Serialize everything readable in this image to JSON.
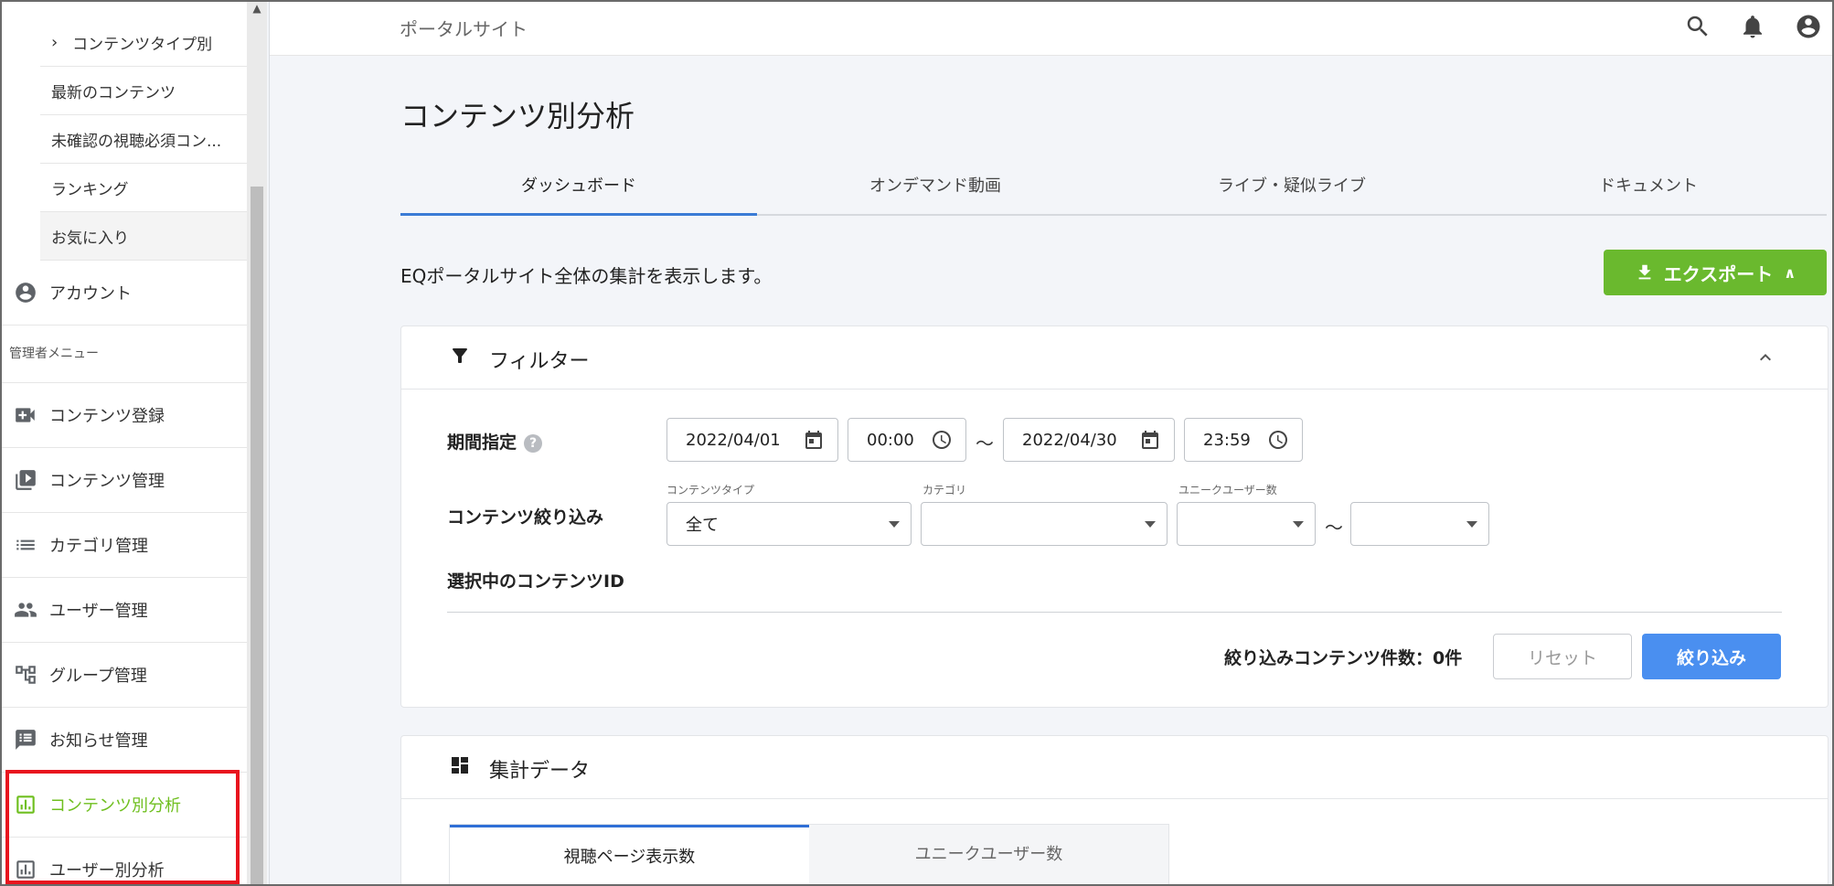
{
  "sidebar": {
    "sub_items": [
      {
        "label": "コンテンツタイプ別"
      },
      {
        "label": "最新のコンテンツ"
      },
      {
        "label": "未確認の視聴必須コン..."
      },
      {
        "label": "ランキング"
      },
      {
        "label": "お気に入り"
      }
    ],
    "account": {
      "label": "アカウント",
      "icon": "account-circle-icon"
    },
    "admin_section": "管理者メニュー",
    "admin_items": [
      {
        "label": "コンテンツ登録",
        "icon": "video-add-icon"
      },
      {
        "label": "コンテンツ管理",
        "icon": "video-library-icon"
      },
      {
        "label": "カテゴリ管理",
        "icon": "list-icon"
      },
      {
        "label": "ユーザー管理",
        "icon": "people-icon"
      },
      {
        "label": "グループ管理",
        "icon": "group-tree-icon"
      },
      {
        "label": "お知らせ管理",
        "icon": "announcement-icon"
      },
      {
        "label": "コンテンツ別分析",
        "icon": "analytics-icon",
        "active": true
      },
      {
        "label": "ユーザー別分析",
        "icon": "analytics-icon"
      }
    ],
    "active_color": "#6fbf1f",
    "highlight_box_color": "#e8141e"
  },
  "header": {
    "portal_title": "ポータルサイト",
    "icons": [
      "search-icon",
      "bell-icon",
      "account-circle-icon"
    ]
  },
  "main": {
    "title": "コンテンツ別分析",
    "tabs": [
      {
        "label": "ダッシュボード",
        "active": true
      },
      {
        "label": "オンデマンド動画"
      },
      {
        "label": "ライブ・疑似ライブ"
      },
      {
        "label": "ドキュメント"
      }
    ],
    "description": "EQポータルサイト全体の集計を表示します。",
    "export_label": "エクスポート",
    "export_color": "#6ab92e"
  },
  "filter": {
    "title": "フィルター",
    "period_label": "期間指定",
    "help": "?",
    "start_date": "2022/04/01",
    "start_time": "00:00",
    "tilde": "～",
    "end_date": "2022/04/30",
    "end_time": "23:59",
    "content_filter_label": "コンテンツ絞り込み",
    "content_type_label": "コンテンツタイプ",
    "content_type_value": "全て",
    "category_label": "カテゴリ",
    "category_value": "",
    "unique_users_label": "ユニークユーザー数",
    "unique_users_min": "",
    "unique_users_max": "",
    "selected_ids_label": "選択中のコンテンツID",
    "count_text": "絞り込みコンテンツ件数：0件",
    "reset_label": "リセット",
    "apply_label": "絞り込み",
    "apply_color": "#4a8ff0"
  },
  "summary": {
    "title": "集計データ",
    "stat_tabs": [
      {
        "label": "視聴ページ表示数",
        "active": true
      },
      {
        "label": "ユニークユーザー数"
      }
    ]
  }
}
